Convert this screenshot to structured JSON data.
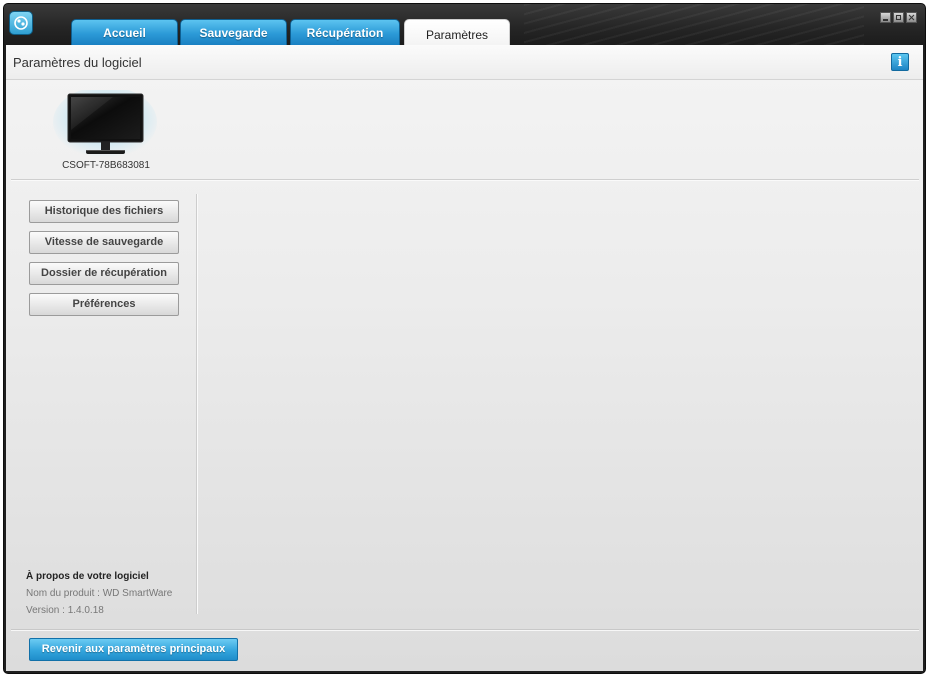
{
  "titlebar": {
    "tabs": [
      {
        "label": "Accueil"
      },
      {
        "label": "Sauvegarde"
      },
      {
        "label": "Récupération"
      },
      {
        "label": "Paramètres"
      }
    ],
    "active_tab": "Paramètres",
    "accent_color": "#2c9ad7"
  },
  "header": {
    "title": "Paramètres du logiciel",
    "info_icon": "i"
  },
  "device": {
    "name": "CSOFT-78B683081",
    "icon": "monitor-icon"
  },
  "sidebar": {
    "buttons": [
      {
        "label": "Historique des fichiers"
      },
      {
        "label": "Vitesse de sauvegarde"
      },
      {
        "label": "Dossier de récupération"
      },
      {
        "label": "Préférences"
      }
    ]
  },
  "about": {
    "heading": "À propos de votre logiciel",
    "product": "Nom du produit : WD SmartWare",
    "version": "Version : 1.4.0.18"
  },
  "footer": {
    "back_label": "Revenir aux paramètres principaux"
  }
}
